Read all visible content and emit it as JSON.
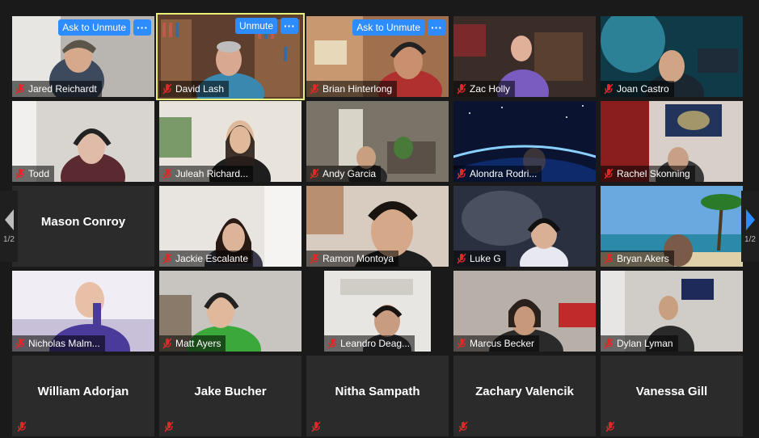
{
  "controls": {
    "ask_to_unmute": "Ask to Unmute",
    "unmute": "Unmute",
    "more": "···"
  },
  "pagination": {
    "left_page": "1/2",
    "right_page": "1/2"
  },
  "colors": {
    "accent": "#2d8cff",
    "active_speaker": "#e8f07a",
    "muted_icon": "#e02828"
  },
  "participants": [
    {
      "name": "Jared Reichardt"
    },
    {
      "name": "David Lash"
    },
    {
      "name": "Brian Hinterlong"
    },
    {
      "name": "Zac Holly"
    },
    {
      "name": "Joan Castro"
    },
    {
      "name": "Todd"
    },
    {
      "name": "Juleah Richard..."
    },
    {
      "name": "Andy Garcia"
    },
    {
      "name": "Alondra Rodri..."
    },
    {
      "name": "Rachel Skonning"
    },
    {
      "name": "Mason Conroy"
    },
    {
      "name": "Jackie Escalante"
    },
    {
      "name": "Ramon Montoya"
    },
    {
      "name": "Luke G"
    },
    {
      "name": "Bryan Akers"
    },
    {
      "name": "Nicholas Malm..."
    },
    {
      "name": "Matt Ayers"
    },
    {
      "name": "Leandro Deag..."
    },
    {
      "name": "Marcus Becker"
    },
    {
      "name": "Dylan Lyman"
    },
    {
      "name": "William Adorjan"
    },
    {
      "name": "Jake Bucher"
    },
    {
      "name": "Nitha Sampath"
    },
    {
      "name": "Zachary Valencik"
    },
    {
      "name": "Vanessa Gill"
    }
  ]
}
